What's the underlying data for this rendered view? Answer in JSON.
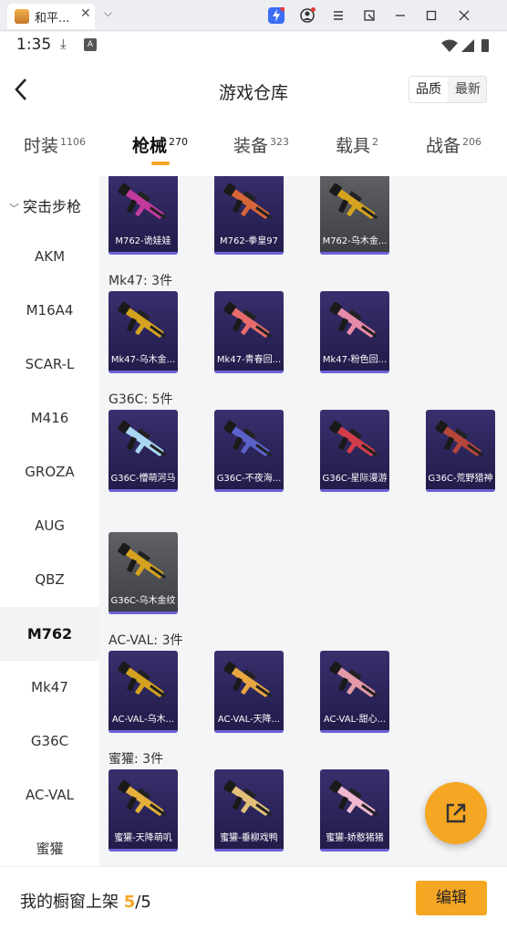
{
  "window": {
    "tab_title": "和平...",
    "tab_close": "✕",
    "tab_dropdown": "⌵"
  },
  "status_bar": {
    "time": "1:35",
    "download_glyph": "⤓",
    "badge": "A"
  },
  "header": {
    "back_glyph": "‹",
    "title": "游戏仓库",
    "sort_quality": "品质",
    "sort_latest": "最新"
  },
  "category_tabs": [
    {
      "label": "时装",
      "count": "1106"
    },
    {
      "label": "枪械",
      "count": "270"
    },
    {
      "label": "装备",
      "count": "323"
    },
    {
      "label": "载具",
      "count": "2"
    },
    {
      "label": "战备",
      "count": "206"
    }
  ],
  "sidebar": {
    "group": "突击步枪",
    "items": [
      "AKM",
      "M16A4",
      "SCAR-L",
      "M416",
      "GROZA",
      "AUG",
      "QBZ",
      "M762",
      "Mk47",
      "G36C",
      "AC-VAL",
      "蜜獾"
    ],
    "active": "M762"
  },
  "sections": [
    {
      "title": "",
      "items": [
        {
          "name": "M762-诡娃娃",
          "style": "purple",
          "color": "#c23a9e"
        },
        {
          "name": "M762-拳皇97",
          "style": "purple",
          "color": "#d7653a"
        },
        {
          "name": "M762-乌木金...",
          "style": "gold",
          "color": "#d4a21e"
        }
      ]
    },
    {
      "title": "Mk47: 3件",
      "items": [
        {
          "name": "Mk47-乌木金...",
          "style": "purple",
          "color": "#d4a21e"
        },
        {
          "name": "Mk47-青春回...",
          "style": "purple",
          "color": "#e76b6b"
        },
        {
          "name": "Mk47-粉色回...",
          "style": "purple",
          "color": "#e58aa8"
        }
      ]
    },
    {
      "title": "G36C: 5件",
      "items": [
        {
          "name": "G36C-懵萌河马",
          "style": "purple",
          "color": "#a9d6f0"
        },
        {
          "name": "G36C-不夜海...",
          "style": "purple",
          "color": "#5b62c9"
        },
        {
          "name": "G36C-星际漫游",
          "style": "purple",
          "color": "#d23d4a"
        },
        {
          "name": "G36C-荒野猎神",
          "style": "purple",
          "color": "#b5463a"
        },
        {
          "name": "G36C-乌木金纹",
          "style": "gold",
          "color": "#d4a21e"
        }
      ]
    },
    {
      "title": "AC-VAL: 3件",
      "items": [
        {
          "name": "AC-VAL-乌木...",
          "style": "purple",
          "color": "#d4a21e"
        },
        {
          "name": "AC-VAL-天降...",
          "style": "purple",
          "color": "#e8a640"
        },
        {
          "name": "AC-VAL-甜心...",
          "style": "purple",
          "color": "#e39aa6"
        }
      ]
    },
    {
      "title": "蜜獾: 3件",
      "items": [
        {
          "name": "蜜獾-天降萌叽",
          "style": "purple",
          "color": "#e3b03a"
        },
        {
          "name": "蜜獾-垂柳戏鸭",
          "style": "purple",
          "color": "#e2c07a"
        },
        {
          "name": "蜜獾-娇憨猪猪",
          "style": "purple",
          "color": "#f0b9cf"
        }
      ]
    }
  ],
  "bottom": {
    "label": "我的橱窗上架 ",
    "count": "5",
    "total": "/5",
    "edit_label": "编辑"
  },
  "colors": {
    "accent": "#f5a623",
    "card_purple": "#2a2458",
    "card_gold": "#4b4c50"
  }
}
